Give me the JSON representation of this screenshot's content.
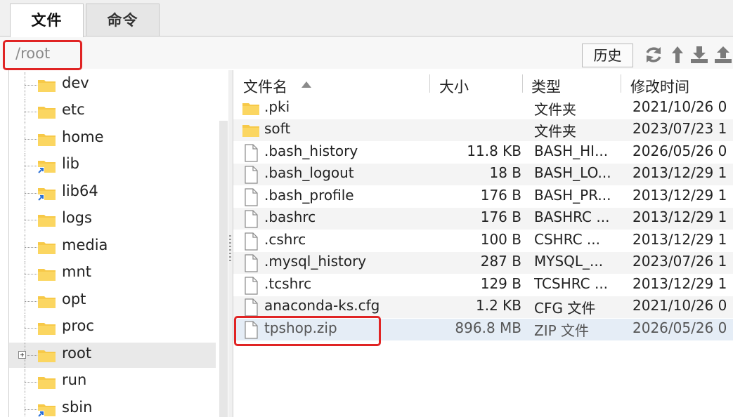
{
  "tabs": [
    {
      "label": "文件",
      "active": true
    },
    {
      "label": "命令",
      "active": false
    }
  ],
  "path": {
    "value": "/root"
  },
  "toolbar": {
    "history_label": "历史",
    "icons": [
      "refresh-icon",
      "up-dir-icon",
      "download-icon",
      "upload-icon"
    ]
  },
  "tree": {
    "items": [
      {
        "label": "dev",
        "icon": "folder-icon"
      },
      {
        "label": "etc",
        "icon": "folder-icon"
      },
      {
        "label": "home",
        "icon": "folder-icon"
      },
      {
        "label": "lib",
        "icon": "folder-link-icon"
      },
      {
        "label": "lib64",
        "icon": "folder-link-icon"
      },
      {
        "label": "logs",
        "icon": "folder-icon"
      },
      {
        "label": "media",
        "icon": "folder-icon"
      },
      {
        "label": "mnt",
        "icon": "folder-icon"
      },
      {
        "label": "opt",
        "icon": "folder-icon"
      },
      {
        "label": "proc",
        "icon": "folder-icon"
      },
      {
        "label": "root",
        "icon": "folder-icon",
        "selected": true,
        "expandable": true
      },
      {
        "label": "run",
        "icon": "folder-icon"
      },
      {
        "label": "sbin",
        "icon": "folder-link-icon"
      }
    ]
  },
  "filelist": {
    "columns": {
      "name": "文件名",
      "size": "大小",
      "type": "类型",
      "modified": "修改时间"
    },
    "rows": [
      {
        "name": ".pki",
        "size": "",
        "type": "文件夹",
        "modified": "2021/10/26 0",
        "kind": "folder"
      },
      {
        "name": "soft",
        "size": "",
        "type": "文件夹",
        "modified": "2023/07/23 1",
        "kind": "folder"
      },
      {
        "name": ".bash_history",
        "size": "11.8 KB",
        "type": "BASH_HI...",
        "modified": "2026/05/26 0",
        "kind": "file"
      },
      {
        "name": ".bash_logout",
        "size": "18 B",
        "type": "BASH_LO...",
        "modified": "2013/12/29 1",
        "kind": "file"
      },
      {
        "name": ".bash_profile",
        "size": "176 B",
        "type": "BASH_PR...",
        "modified": "2013/12/29 1",
        "kind": "file"
      },
      {
        "name": ".bashrc",
        "size": "176 B",
        "type": "BASHRC ...",
        "modified": "2013/12/29 1",
        "kind": "file"
      },
      {
        "name": ".cshrc",
        "size": "100 B",
        "type": "CSHRC ...",
        "modified": "2013/12/29 1",
        "kind": "file"
      },
      {
        "name": ".mysql_history",
        "size": "287 B",
        "type": "MYSQL_...",
        "modified": "2023/07/26 1",
        "kind": "file"
      },
      {
        "name": ".tcshrc",
        "size": "129 B",
        "type": "TCSHRC ...",
        "modified": "2013/12/29 1",
        "kind": "file"
      },
      {
        "name": "anaconda-ks.cfg",
        "size": "1.2 KB",
        "type": "CFG 文件",
        "modified": "2021/10/26 0",
        "kind": "file"
      },
      {
        "name": "tpshop.zip",
        "size": "896.8 MB",
        "type": "ZIP 文件",
        "modified": "2026/05/26 0",
        "kind": "file",
        "selected": true
      }
    ]
  },
  "colors": {
    "highlight": "#e02424",
    "folder": "#f7c948",
    "selection": "#e5edf6"
  }
}
